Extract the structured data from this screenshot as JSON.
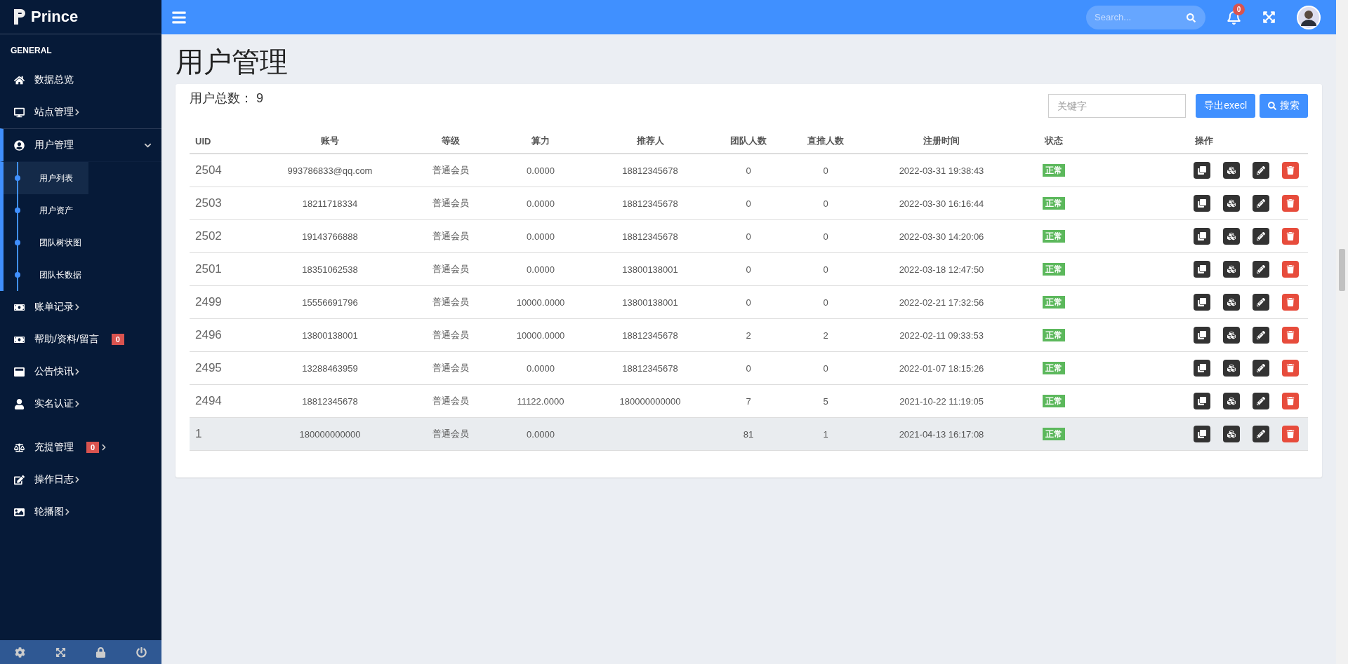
{
  "brand": {
    "name": "Prince"
  },
  "sidebar": {
    "section": "GENERAL",
    "items": [
      {
        "label": "数据总览",
        "arrow": false
      },
      {
        "label": "站点管理",
        "arrow": true
      },
      {
        "label": "用户管理",
        "expanded": true,
        "children": [
          {
            "label": "用户列表",
            "selected": true
          },
          {
            "label": "用户资产",
            "selected": false
          },
          {
            "label": "团队树状图",
            "selected": false
          },
          {
            "label": "团队长数据",
            "selected": false
          }
        ]
      },
      {
        "label": "账单记录",
        "arrow": true
      },
      {
        "label": "帮助/资料/留言",
        "arrow": false,
        "badge": "0"
      },
      {
        "label": "公告快讯",
        "arrow": true
      },
      {
        "label": "实名认证",
        "arrow": true
      },
      {
        "label": "充提管理",
        "arrow": true,
        "badge": "0",
        "gap": true
      },
      {
        "label": "操作日志",
        "arrow": true
      },
      {
        "label": "轮播图",
        "arrow": true
      }
    ]
  },
  "topbar": {
    "search": {
      "placeholder": "Search..."
    },
    "notifications": "0"
  },
  "page": {
    "title": "用户管理"
  },
  "card": {
    "total_label": "用户总数：",
    "total": "9",
    "keyword": {
      "placeholder": "关键字"
    },
    "buttons": [
      {
        "label": "导出execl",
        "kind": "plain"
      },
      {
        "label": "搜索",
        "kind": "search"
      }
    ]
  },
  "table": {
    "columns": [
      "UID",
      "账号",
      "等级",
      "算力",
      "推荐人",
      "团队人数",
      "直推人数",
      "注册时间",
      "状态",
      "操作"
    ],
    "rows": [
      {
        "uid": "2504",
        "account": "993786833@qq.com",
        "level": "普通会员",
        "power": "0.0000",
        "referrer": "18812345678",
        "team": "0",
        "direct": "0",
        "registered": "2022-03-31 19:38:43",
        "status": "正常",
        "highlighted": false
      },
      {
        "uid": "2503",
        "account": "18211718334",
        "level": "普通会员",
        "power": "0.0000",
        "referrer": "18812345678",
        "team": "0",
        "direct": "0",
        "registered": "2022-03-30 16:16:44",
        "status": "正常",
        "highlighted": false
      },
      {
        "uid": "2502",
        "account": "19143766888",
        "level": "普通会员",
        "power": "0.0000",
        "referrer": "18812345678",
        "team": "0",
        "direct": "0",
        "registered": "2022-03-30 14:20:06",
        "status": "正常",
        "highlighted": false
      },
      {
        "uid": "2501",
        "account": "18351062538",
        "level": "普通会员",
        "power": "0.0000",
        "referrer": "13800138001",
        "team": "0",
        "direct": "0",
        "registered": "2022-03-18 12:47:50",
        "status": "正常",
        "highlighted": false
      },
      {
        "uid": "2499",
        "account": "15556691796",
        "level": "普通会员",
        "power": "10000.0000",
        "referrer": "13800138001",
        "team": "0",
        "direct": "0",
        "registered": "2022-02-21 17:32:56",
        "status": "正常",
        "highlighted": false
      },
      {
        "uid": "2496",
        "account": "13800138001",
        "level": "普通会员",
        "power": "10000.0000",
        "referrer": "18812345678",
        "team": "2",
        "direct": "2",
        "registered": "2022-02-11 09:33:53",
        "status": "正常",
        "highlighted": false
      },
      {
        "uid": "2495",
        "account": "13288463959",
        "level": "普通会员",
        "power": "0.0000",
        "referrer": "18812345678",
        "team": "0",
        "direct": "0",
        "registered": "2022-01-07 18:15:26",
        "status": "正常",
        "highlighted": false
      },
      {
        "uid": "2494",
        "account": "18812345678",
        "level": "普通会员",
        "power": "11122.0000",
        "referrer": "180000000000",
        "team": "7",
        "direct": "5",
        "registered": "2021-10-22 11:19:05",
        "status": "正常",
        "highlighted": false
      },
      {
        "uid": "1",
        "account": "180000000000",
        "level": "普通会员",
        "power": "0.0000",
        "team": "81",
        "direct": "1",
        "registered": "2021-04-13 16:17:08",
        "status": "正常",
        "highlighted": true
      }
    ]
  }
}
